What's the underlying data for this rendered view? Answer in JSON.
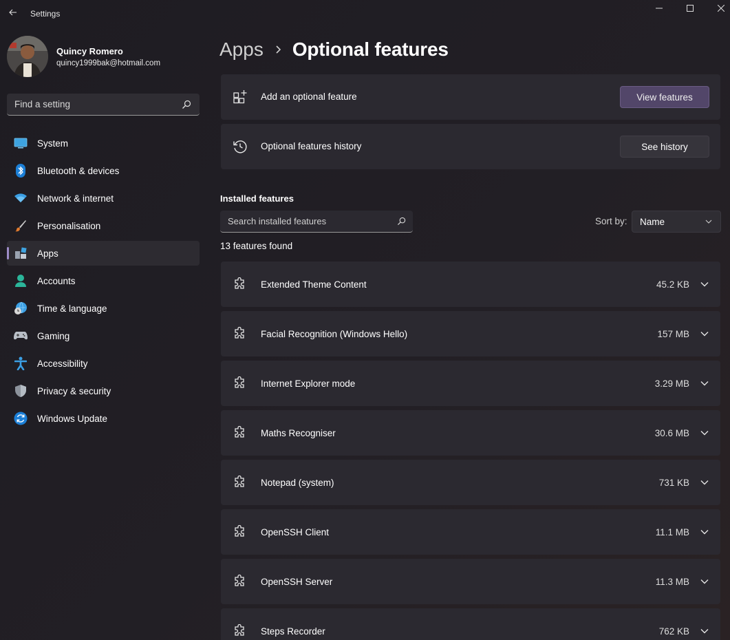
{
  "titlebar": {
    "title": "Settings",
    "back_icon": "back-arrow-icon",
    "controls": [
      "minimize-icon",
      "maximize-icon",
      "close-icon"
    ]
  },
  "profile": {
    "name": "Quincy Romero",
    "email": "quincy1999bak@hotmail.com"
  },
  "search": {
    "placeholder": "Find a setting"
  },
  "sidebar": {
    "items": [
      {
        "label": "System",
        "icon": "system-display-icon",
        "active": false
      },
      {
        "label": "Bluetooth & devices",
        "icon": "bluetooth-icon",
        "active": false
      },
      {
        "label": "Network & internet",
        "icon": "wifi-icon",
        "active": false
      },
      {
        "label": "Personalisation",
        "icon": "paintbrush-icon",
        "active": false
      },
      {
        "label": "Apps",
        "icon": "apps-icon",
        "active": true
      },
      {
        "label": "Accounts",
        "icon": "accounts-icon",
        "active": false
      },
      {
        "label": "Time & language",
        "icon": "globe-clock-icon",
        "active": false
      },
      {
        "label": "Gaming",
        "icon": "gamepad-icon",
        "active": false
      },
      {
        "label": "Accessibility",
        "icon": "accessibility-icon",
        "active": false
      },
      {
        "label": "Privacy & security",
        "icon": "shield-icon",
        "active": false
      },
      {
        "label": "Windows Update",
        "icon": "windows-update-icon",
        "active": false
      }
    ]
  },
  "breadcrumb": {
    "parent": "Apps",
    "current": "Optional features"
  },
  "cards": {
    "add": {
      "label": "Add an optional feature",
      "button": "View features"
    },
    "history": {
      "label": "Optional features history",
      "button": "See history"
    }
  },
  "installed": {
    "title": "Installed features",
    "search_placeholder": "Search installed features",
    "sort_label": "Sort by:",
    "sort_value": "Name",
    "count_text": "13 features found",
    "features": [
      {
        "name": "Extended Theme Content",
        "size": "45.2 KB"
      },
      {
        "name": "Facial Recognition (Windows Hello)",
        "size": "157 MB"
      },
      {
        "name": "Internet Explorer mode",
        "size": "3.29 MB"
      },
      {
        "name": "Maths Recogniser",
        "size": "30.6 MB"
      },
      {
        "name": "Notepad (system)",
        "size": "731 KB"
      },
      {
        "name": "OpenSSH Client",
        "size": "11.1 MB"
      },
      {
        "name": "OpenSSH Server",
        "size": "11.3 MB"
      },
      {
        "name": "Steps Recorder",
        "size": "762 KB"
      }
    ]
  },
  "colors": {
    "accent": "#9e8cc8",
    "accent_button": "#524669",
    "card_bg": "#2b2930",
    "window_bg": "#1f1d22"
  }
}
